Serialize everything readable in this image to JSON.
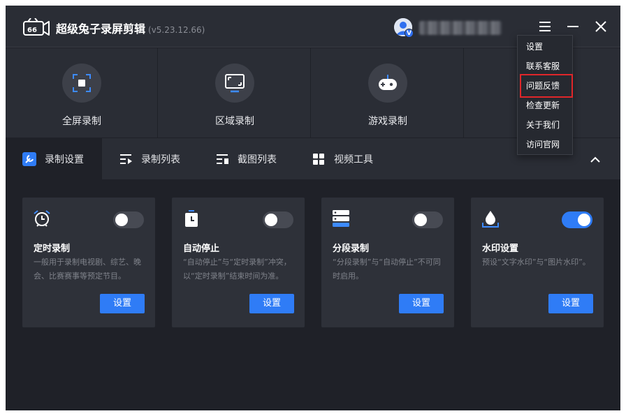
{
  "app": {
    "title": "超级兔子录屏剪辑",
    "version": "(v5.23.12.66)"
  },
  "user": {
    "badge": "V"
  },
  "modes": [
    {
      "label": "全屏录制",
      "icon": "fullscreen-record-icon"
    },
    {
      "label": "区域录制",
      "icon": "region-record-icon"
    },
    {
      "label": "游戏录制",
      "icon": "gamepad-icon"
    }
  ],
  "tabs": [
    {
      "label": "录制设置",
      "icon": "wrench-icon",
      "active": true
    },
    {
      "label": "录制列表",
      "icon": "record-list-icon",
      "active": false
    },
    {
      "label": "截图列表",
      "icon": "screenshot-list-icon",
      "active": false
    },
    {
      "label": "视频工具",
      "icon": "grid-tools-icon",
      "active": false
    }
  ],
  "cards": [
    {
      "title": "定时录制",
      "desc": "一般用于录制电视剧、综艺、晚会、比赛赛事等预定节目。",
      "button": "设置",
      "enabled": false,
      "icon": "alarm-clock-icon"
    },
    {
      "title": "自动停止",
      "desc": "“自动停止”与“定时录制”冲突，以“定时录制”结束时间为准。",
      "button": "设置",
      "enabled": false,
      "icon": "timer-icon"
    },
    {
      "title": "分段录制",
      "desc": "“分段录制”与“自动停止”不可同时启用。",
      "button": "设置",
      "enabled": false,
      "icon": "segments-icon"
    },
    {
      "title": "水印设置",
      "desc": "预设“文字水印”与“图片水印”。",
      "button": "设置",
      "enabled": true,
      "icon": "watermark-drop-icon"
    }
  ],
  "menu": {
    "items": [
      "设置",
      "联系客服",
      "问题反馈",
      "检查更新",
      "关于我们",
      "访问官网"
    ],
    "highlighted": "问题反馈"
  },
  "colors": {
    "accent": "#2f7cf6",
    "highlight_border": "#e0262a",
    "background": "#1f2128",
    "panel": "#2a2d35"
  }
}
